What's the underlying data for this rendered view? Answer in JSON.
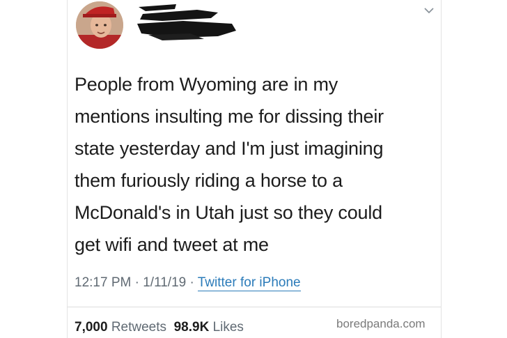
{
  "tweet": {
    "text": "People from Wyoming are in my\nmentions insulting me for dissing their\nstate yesterday and I'm just imagining\nthem furiously riding a horse to a\nMcDonald's in Utah just so they could\nget wifi and tweet at me",
    "time": "12:17 PM",
    "date": "1/11/19",
    "separator": "·",
    "source": "Twitter for iPhone"
  },
  "stats": {
    "retweets_count": "7,000",
    "retweets_label": "Retweets",
    "likes_count": "98.9K",
    "likes_label": "Likes"
  },
  "watermark": "boredpanda.com",
  "icons": {
    "menu": "chevron-down-icon",
    "avatar": "avatar"
  }
}
